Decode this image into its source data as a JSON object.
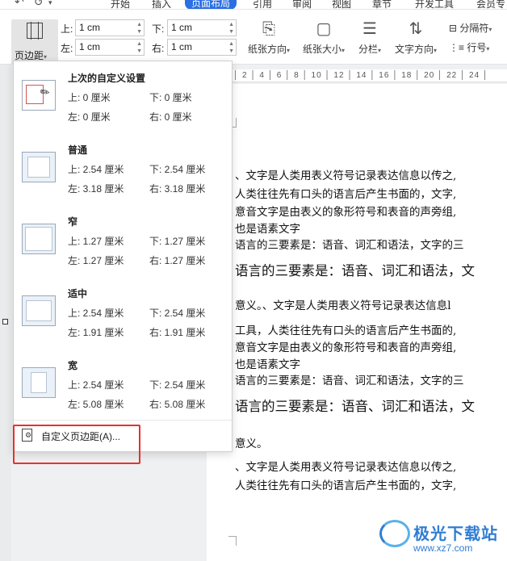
{
  "menubar": {
    "items": [
      "开始",
      "插入",
      "页面布局",
      "引用",
      "审阅",
      "视图",
      "章节",
      "开发工具",
      "会员专"
    ],
    "active": "页面布局"
  },
  "ribbon": {
    "margin_button_label": "页边距",
    "margins": {
      "top_label": "上:",
      "top_value": "1 cm",
      "bottom_label": "下:",
      "bottom_value": "1 cm",
      "left_label": "左:",
      "left_value": "1 cm",
      "right_label": "右:",
      "right_value": "1 cm"
    },
    "tools": [
      {
        "label": "纸张方向",
        "icon": "paper-orientation-icon"
      },
      {
        "label": "纸张大小",
        "icon": "paper-size-icon"
      },
      {
        "label": "分栏",
        "icon": "columns-icon"
      },
      {
        "label": "文字方向",
        "icon": "text-direction-icon"
      }
    ],
    "breaks_label": "分隔符",
    "line_numbers_label": "行号"
  },
  "dropdown": {
    "presets": [
      {
        "name": "上次的自定义设置",
        "top": "上: 0 厘米",
        "bottom": "下: 0 厘米",
        "left": "左: 0 厘米",
        "right": "右: 0 厘米"
      },
      {
        "name": "普通",
        "top": "上: 2.54 厘米",
        "bottom": "下: 2.54 厘米",
        "left": "左: 3.18 厘米",
        "right": "右: 3.18 厘米"
      },
      {
        "name": "窄",
        "top": "上: 1.27 厘米",
        "bottom": "下: 1.27 厘米",
        "left": "左: 1.27 厘米",
        "right": "右: 1.27 厘米"
      },
      {
        "name": "适中",
        "top": "上: 2.54 厘米",
        "bottom": "下: 2.54 厘米",
        "left": "左: 1.91 厘米",
        "right": "右: 1.91 厘米"
      },
      {
        "name": "宽",
        "top": "上: 2.54 厘米",
        "bottom": "下: 2.54 厘米",
        "left": "左: 5.08 厘米",
        "right": "右: 5.08 厘米"
      }
    ],
    "custom_label": "自定义页边距(A)..."
  },
  "document": {
    "lines": [
      "、文字是人类用表义符号记录表达信息以传之,",
      "人类往往先有口头的语言后产生书面的，文字,",
      "意音文字是由表义的象形符号和表音的声旁组,",
      "也是语素文字",
      "语言的三要素是：语音、词汇和语法，文字的三",
      "语言的三要素是：语音、词汇和语法，文",
      "意义。、文字是人类用表义符号记录表达信息l",
      "工具，人类往往先有口头的语言后产生书面的,",
      "意音文字是由表义的象形符号和表音的声旁组,",
      "也是语素文字",
      "语言的三要素是：语音、词汇和语法，文字的三",
      "语言的三要素是：语音、词汇和语法，文",
      "意义。",
      "、文字是人类用表义符号记录表达信息以传之,",
      "人类往往先有口头的语言后产生书面的，文字,"
    ]
  },
  "watermark": {
    "title": "极光下载站",
    "url": "www.xz7.com"
  }
}
